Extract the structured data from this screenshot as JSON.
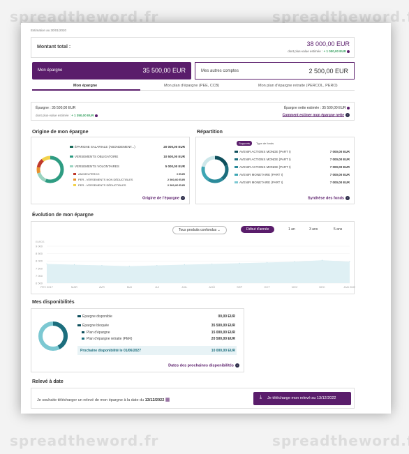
{
  "watermark": "spreadtheword.fr",
  "estimation": "Estimation au 30/01/2020",
  "total": {
    "label": "Montant total :",
    "amount": "38 000,00 EUR",
    "gain_label": "dont plus-value estimée :",
    "gain_value": "+ 1 000,00 EUR"
  },
  "cards": {
    "epargne_label": "Mon épargne",
    "epargne_amount": "35 500,00 EUR",
    "autres_label": "Mes autres comptes",
    "autres_amount": "2 500,00 EUR"
  },
  "tabs": [
    "Mon épargne",
    "Mon plan d'épargne (PEE, CCB)",
    "Mon plan d'épargne retraite (PERCOL, PERO)"
  ],
  "summary": {
    "epargne": "Épargne : 35 500,00 EUR",
    "pv_label": "dont plus-value estimée :",
    "pv_value": "+ 1 350,00 EUR",
    "nette": "Épargne nette estimée : 35 500,00 EUR",
    "nette_link": "Comment estimer mon épargne nette"
  },
  "origine": {
    "title": "Origine de mon épargne",
    "rows": [
      {
        "label": "ÉPARGNE SALARIALE (ABONDEMENT...)",
        "value": "20 000,00 EUR",
        "color": "#1a6b5a"
      },
      {
        "label": "VERSEMENTS OBLIGATOIRE",
        "value": "10 500,00 EUR",
        "color": "#2e9c82"
      },
      {
        "label": "VERSEMENTS VOLONTAIRES",
        "value": "5 000,00 EUR",
        "color": "#9ad3c0"
      }
    ],
    "subrows": [
      {
        "label": "ANCIEN PERCO",
        "value": "0 EUR",
        "color": "#c0392b"
      },
      {
        "label": "PER - VERSEMENTS NON DÉDUCTIBLES",
        "value": "2 500,00 EUR",
        "color": "#e8912d"
      },
      {
        "label": "PER - VERSEMENTS DÉDUCTIBLES",
        "value": "2 500,00 EUR",
        "color": "#f2d24b"
      }
    ],
    "link": "Origine de l'épargne"
  },
  "repartition": {
    "title": "Répartition",
    "tab_active": "Supports",
    "tab_other": "Type de fonds",
    "rows": [
      {
        "label": "AVENIR ACTIONS MONDE (PART I)",
        "value": "7 000,00 EUR",
        "color": "#0e4f5c"
      },
      {
        "label": "AVENIR ACTIONS MONDE (PART I)",
        "value": "7 000,00 EUR",
        "color": "#1c6e7d"
      },
      {
        "label": "AVENIR ACTIONS MONDE (PART I)",
        "value": "7 000,00 EUR",
        "color": "#2b8a9a"
      },
      {
        "label": "AVENIR MONETAIRE (PART I)",
        "value": "7 000,00 EUR",
        "color": "#3ea6b4"
      },
      {
        "label": "AVENIR MONETAIRE (PART I)",
        "value": "7 000,00 EUR",
        "color": "#7cc8d2"
      }
    ],
    "link": "Synthèse des fonds"
  },
  "evolution": {
    "title": "Évolution de mon épargne",
    "select": "Tous produits confondus",
    "periods": [
      "Début d'année",
      "1 an",
      "3 ans",
      "5 ans"
    ],
    "yunit": "EUROS",
    "yticks": [
      "9 000",
      "8 500",
      "8 000",
      "7 500",
      "7 000",
      "6 500"
    ],
    "xticks": [
      "FEV 2017",
      "MAR",
      "AVR",
      "MAI",
      "JUI",
      "JUIL",
      "AOÛ",
      "SEP",
      "OCT",
      "NOV",
      "DEC",
      "JAN 2020"
    ]
  },
  "chart_data": {
    "type": "area",
    "x": [
      "FEV 2017",
      "MAR",
      "AVR",
      "MAI",
      "JUI",
      "JUIL",
      "AOÛ",
      "SEP",
      "OCT",
      "NOV",
      "DEC",
      "JAN 2020"
    ],
    "series": [
      {
        "values": [
          7800,
          7750,
          7700,
          7650,
          7700,
          7750,
          7800,
          7850,
          7900,
          7950,
          8050,
          7950
        ]
      }
    ],
    "ylim": [
      6500,
      9000
    ]
  },
  "dispo": {
    "title": "Mes disponibilités",
    "rows": [
      {
        "label": "Épargne disponible",
        "value": "00,00 EUR"
      },
      {
        "label": "Épargne bloquée",
        "value": "35 500,00 EUR"
      },
      {
        "label": "Plan d'épargne",
        "value": "15 000,00 EUR"
      },
      {
        "label": "Plan d'épargne retraite (PER)",
        "value": "20 500,00 EUR"
      }
    ],
    "next_label": "Prochaine disponibilité le 01/06/2027",
    "next_value": "10 000,00 EUR",
    "link": "Dates des prochaines disponibilités"
  },
  "releve": {
    "title": "Relevé à date",
    "text": "Je souhaite télécharger un relevé de mon épargne à la date du",
    "date": "13/12/2022",
    "button": "Je télécharge mon relevé au 13/12/2022"
  }
}
